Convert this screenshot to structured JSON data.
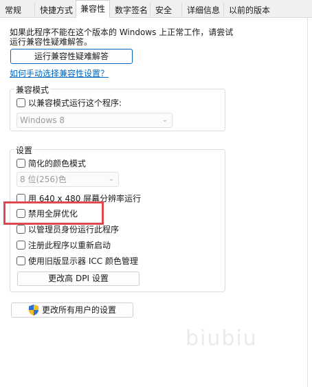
{
  "tabs": [
    "常规",
    "快捷方式",
    "兼容性",
    "数字签名",
    "安全",
    "详细信息",
    "以前的版本"
  ],
  "active_tab": "兼容性",
  "intro_line1": "如果此程序不能在这个版本的 Windows 上正常工作，请尝试",
  "intro_line2": "运行兼容性疑难解答。",
  "troubleshoot_button": "运行兼容性疑难解答",
  "manual_link": "如何手动选择兼容性设置？",
  "compat_mode": {
    "legend": "兼容模式",
    "checkbox": "以兼容模式运行这个程序:",
    "select_value": "Windows 8"
  },
  "settings": {
    "legend": "设置",
    "reduced_color": "简化的颜色模式",
    "color_select": "8 位(256)色",
    "run_640": "用 640 x 480 屏幕分辨率运行",
    "disable_fullscreen": "禁用全屏优化",
    "run_admin": "以管理员身份运行此程序",
    "register_restart": "注册此程序以重新启动",
    "legacy_icc": "使用旧版显示器 ICC 颜色管理",
    "dpi_button": "更改高 DPI 设置"
  },
  "all_users_button": "更改所有用户的设置",
  "watermark": "biubiu",
  "colors": {
    "highlight": "#e0484f",
    "link": "#0067c0",
    "shield_blue": "#2f6fd1",
    "shield_yellow": "#f2c01c"
  }
}
